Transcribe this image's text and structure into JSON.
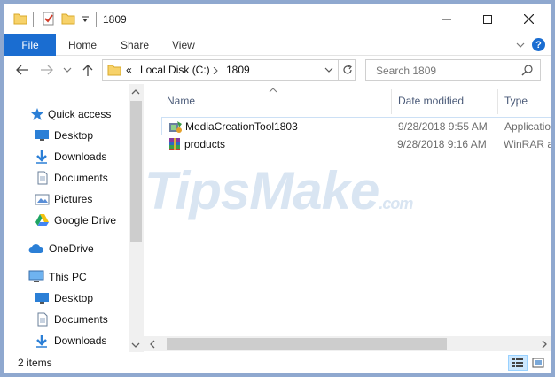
{
  "window": {
    "title": "1809",
    "controls": {
      "minimize": "—",
      "maximize": "☐",
      "close": "✕"
    }
  },
  "ribbon": {
    "tabs": [
      "File",
      "Home",
      "Share",
      "View"
    ],
    "help": "?"
  },
  "address": {
    "overflow": "<<",
    "crumbs": [
      "Local Disk (C:)",
      "1809"
    ]
  },
  "search": {
    "placeholder": "Search 1809"
  },
  "nav_pane": {
    "quick_access": {
      "label": "Quick access",
      "items": [
        {
          "label": "Desktop",
          "icon": "desktop-icon",
          "pinned": true
        },
        {
          "label": "Downloads",
          "icon": "download-icon",
          "pinned": true
        },
        {
          "label": "Documents",
          "icon": "documents-icon",
          "pinned": true
        },
        {
          "label": "Pictures",
          "icon": "pictures-icon",
          "pinned": true
        },
        {
          "label": "Google Drive",
          "icon": "google-drive-icon",
          "pinned": true
        }
      ]
    },
    "onedrive": {
      "label": "OneDrive"
    },
    "this_pc": {
      "label": "This PC",
      "items": [
        {
          "label": "Desktop",
          "icon": "desktop-icon"
        },
        {
          "label": "Documents",
          "icon": "documents-icon"
        },
        {
          "label": "Downloads",
          "icon": "download-icon"
        }
      ]
    }
  },
  "columns": {
    "name": "Name",
    "date": "Date modified",
    "type": "Type"
  },
  "files": [
    {
      "name": "MediaCreationTool1803",
      "date": "9/28/2018 9:55 AM",
      "type": "Applicatio",
      "icon": "media-creation-tool-icon"
    },
    {
      "name": "products",
      "date": "9/28/2018 9:16 AM",
      "type": "WinRAR ar",
      "icon": "winrar-archive-icon"
    }
  ],
  "watermark": {
    "text": "TipsMake",
    "suffix": ".com"
  },
  "status": {
    "items": "2 items"
  },
  "colors": {
    "accent": "#1a6dd1",
    "selection_border": "#cce0f5",
    "folder": "#f7d26a"
  }
}
